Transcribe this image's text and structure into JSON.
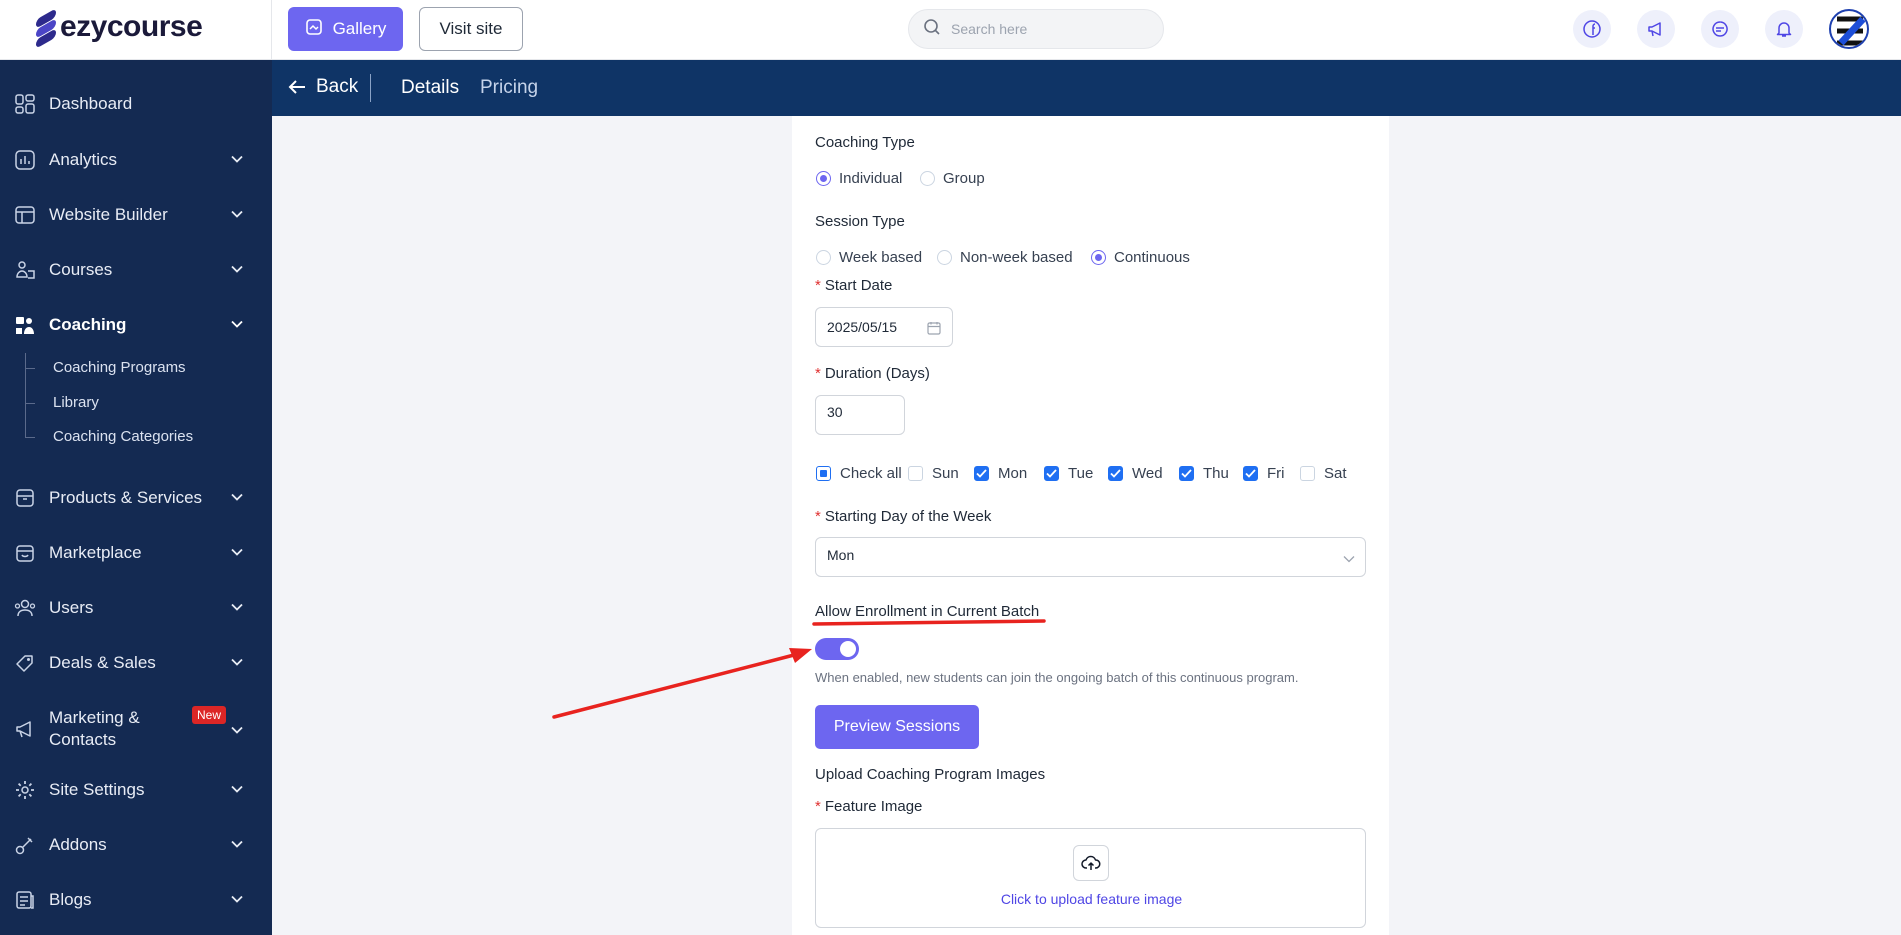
{
  "brand": {
    "name": "ezycourse"
  },
  "topbar": {
    "gallery_label": "Gallery",
    "visit_label": "Visit site",
    "search_placeholder": "Search here",
    "icons": [
      "facebook-icon",
      "megaphone-icon",
      "chat-icon",
      "bell-icon"
    ]
  },
  "sidebar": {
    "items": [
      {
        "label": "Dashboard",
        "icon": "dashboard-icon"
      },
      {
        "label": "Analytics",
        "icon": "analytics-icon"
      },
      {
        "label": "Website Builder",
        "icon": "website-builder-icon"
      },
      {
        "label": "Courses",
        "icon": "courses-icon"
      },
      {
        "label": "Coaching",
        "icon": "coaching-icon"
      },
      {
        "label": "Products & Services",
        "icon": "box-icon"
      },
      {
        "label": "Marketplace",
        "icon": "marketplace-icon"
      },
      {
        "label": "Users",
        "icon": "users-icon"
      },
      {
        "label": "Deals & Sales",
        "icon": "tag-icon"
      },
      {
        "label": "Marketing &",
        "label2": "Contacts",
        "icon": "megaphone-icon",
        "badge": "New"
      },
      {
        "label": "Site Settings",
        "icon": "gear-icon"
      },
      {
        "label": "Addons",
        "icon": "addons-icon"
      },
      {
        "label": "Blogs",
        "icon": "blog-icon"
      }
    ],
    "coaching_sub": [
      "Coaching Programs",
      "Library",
      "Coaching Categories"
    ]
  },
  "subheader": {
    "back_label": "Back",
    "tabs": [
      "Details",
      "Pricing"
    ]
  },
  "form": {
    "coaching_type": {
      "label": "Coaching Type",
      "options": [
        "Individual",
        "Group"
      ],
      "selected": "Individual"
    },
    "session_type": {
      "label": "Session Type",
      "options": [
        "Week based",
        "Non-week based",
        "Continuous"
      ],
      "selected": "Continuous"
    },
    "start_date": {
      "label": "Start Date",
      "value": "2025/05/15"
    },
    "duration": {
      "label": "Duration (Days)",
      "value": "30"
    },
    "days": {
      "check_all": "Check all",
      "items": [
        {
          "label": "Sun",
          "checked": false
        },
        {
          "label": "Mon",
          "checked": true
        },
        {
          "label": "Tue",
          "checked": true
        },
        {
          "label": "Wed",
          "checked": true
        },
        {
          "label": "Thu",
          "checked": true
        },
        {
          "label": "Fri",
          "checked": true
        },
        {
          "label": "Sat",
          "checked": false
        }
      ]
    },
    "starting_day": {
      "label": "Starting Day of the Week",
      "value": "Mon"
    },
    "allow_enrollment": {
      "label": "Allow Enrollment in Current Batch",
      "enabled": true,
      "hint": "When enabled, new students can join the ongoing batch of this continuous program."
    },
    "preview_label": "Preview Sessions",
    "upload_heading": "Upload Coaching Program Images",
    "feature_image_label": "Feature Image",
    "upload_text": "Click to upload feature image"
  },
  "colors": {
    "accent": "#6d66f0",
    "sidebar": "#142a52",
    "subheader": "#0f3466",
    "annotation": "#e8231f"
  }
}
